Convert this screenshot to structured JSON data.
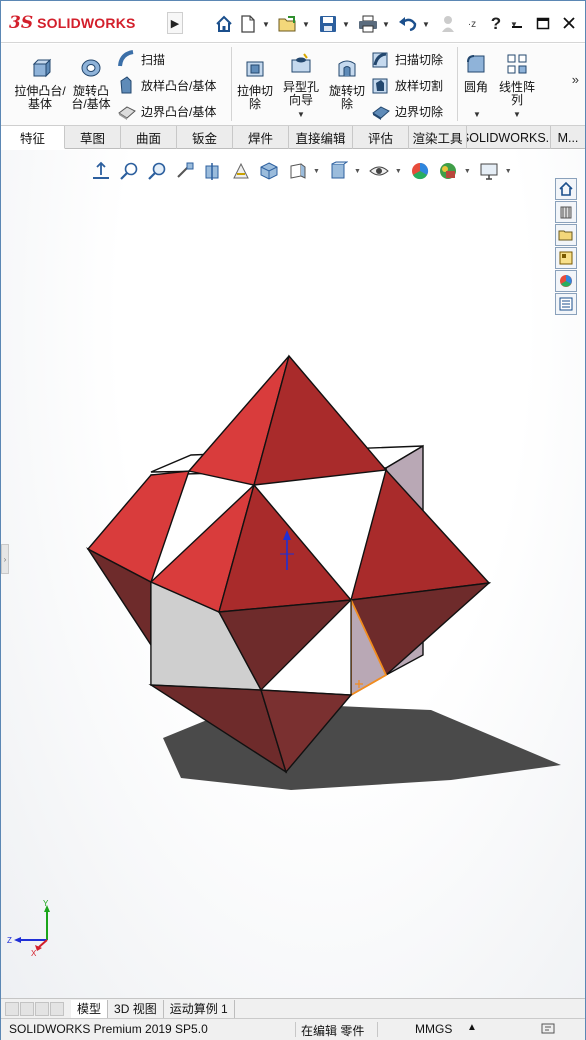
{
  "app": {
    "logo_ds": "3S",
    "logo_text": "SOLIDWORKS"
  },
  "ribbon": {
    "extrude_boss": "拉伸凸台/基体",
    "revolve_boss": "旋转凸台/基体",
    "sweep": "扫描",
    "loft_boss": "放样凸台/基体",
    "boundary_boss": "边界凸台/基体",
    "extrude_cut": "拉伸切除",
    "hole_wizard": "异型孔向导",
    "revolve_cut": "旋转切除",
    "swept_cut": "扫描切除",
    "lofted_cut": "放样切割",
    "boundary_cut": "边界切除",
    "fillet": "圆角",
    "linear_pattern": "线性阵列"
  },
  "tabs": [
    "特征",
    "草图",
    "曲面",
    "钣金",
    "焊件",
    "直接编辑",
    "评估",
    "渲染工具",
    "SOLIDWORKS...",
    "M..."
  ],
  "bottom_tabs": [
    "模型",
    "3D 视图",
    "运动算例 1"
  ],
  "status": {
    "product": "SOLIDWORKS Premium 2019 SP5.0",
    "mode": "在编辑 零件",
    "units": "MMGS"
  },
  "triad": {
    "y": "Y",
    "z": "Z",
    "x": "X"
  },
  "colors": {
    "logo_red": "#d31f2b",
    "face_red": "#d93c3c",
    "face_red_dark": "#a82a2a",
    "face_maroon": "#6f2e2e",
    "selection_orange": "#f28c1e",
    "sketch_blue": "#1f2fd6"
  }
}
